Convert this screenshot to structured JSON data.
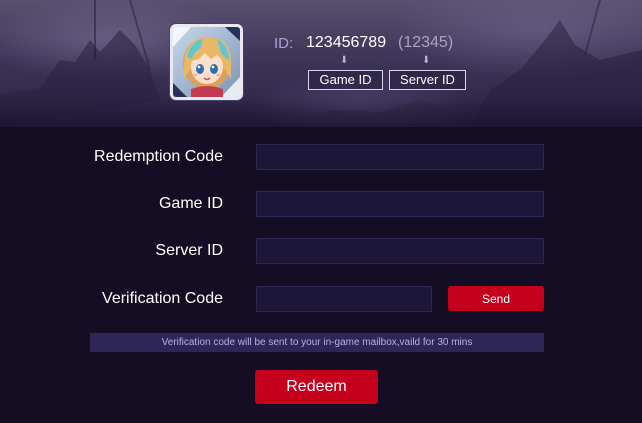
{
  "header": {
    "id_label": "ID:",
    "game_id": "123456789",
    "server_id": "(12345)",
    "arrow": "⬇",
    "game_id_tag": "Game ID",
    "server_id_tag": "Server ID",
    "avatar_icon": "character-portrait"
  },
  "form": {
    "redemption_code_label": "Redemption Code",
    "redemption_code_value": "",
    "game_id_label": "Game ID",
    "game_id_value": "",
    "server_id_label": "Server ID",
    "server_id_value": "",
    "verification_code_label": "Verification Code",
    "verification_code_value": "",
    "send_label": "Send",
    "notice": "Verification code will be sent to your in-game mailbox,vaild for 30 mins",
    "redeem_label": "Redeem"
  },
  "colors": {
    "accent_red": "#c4001c",
    "background": "#150d24",
    "input_bg": "#1c1738",
    "notice_bg": "#2d2657",
    "id_label": "#a7a3d8"
  }
}
